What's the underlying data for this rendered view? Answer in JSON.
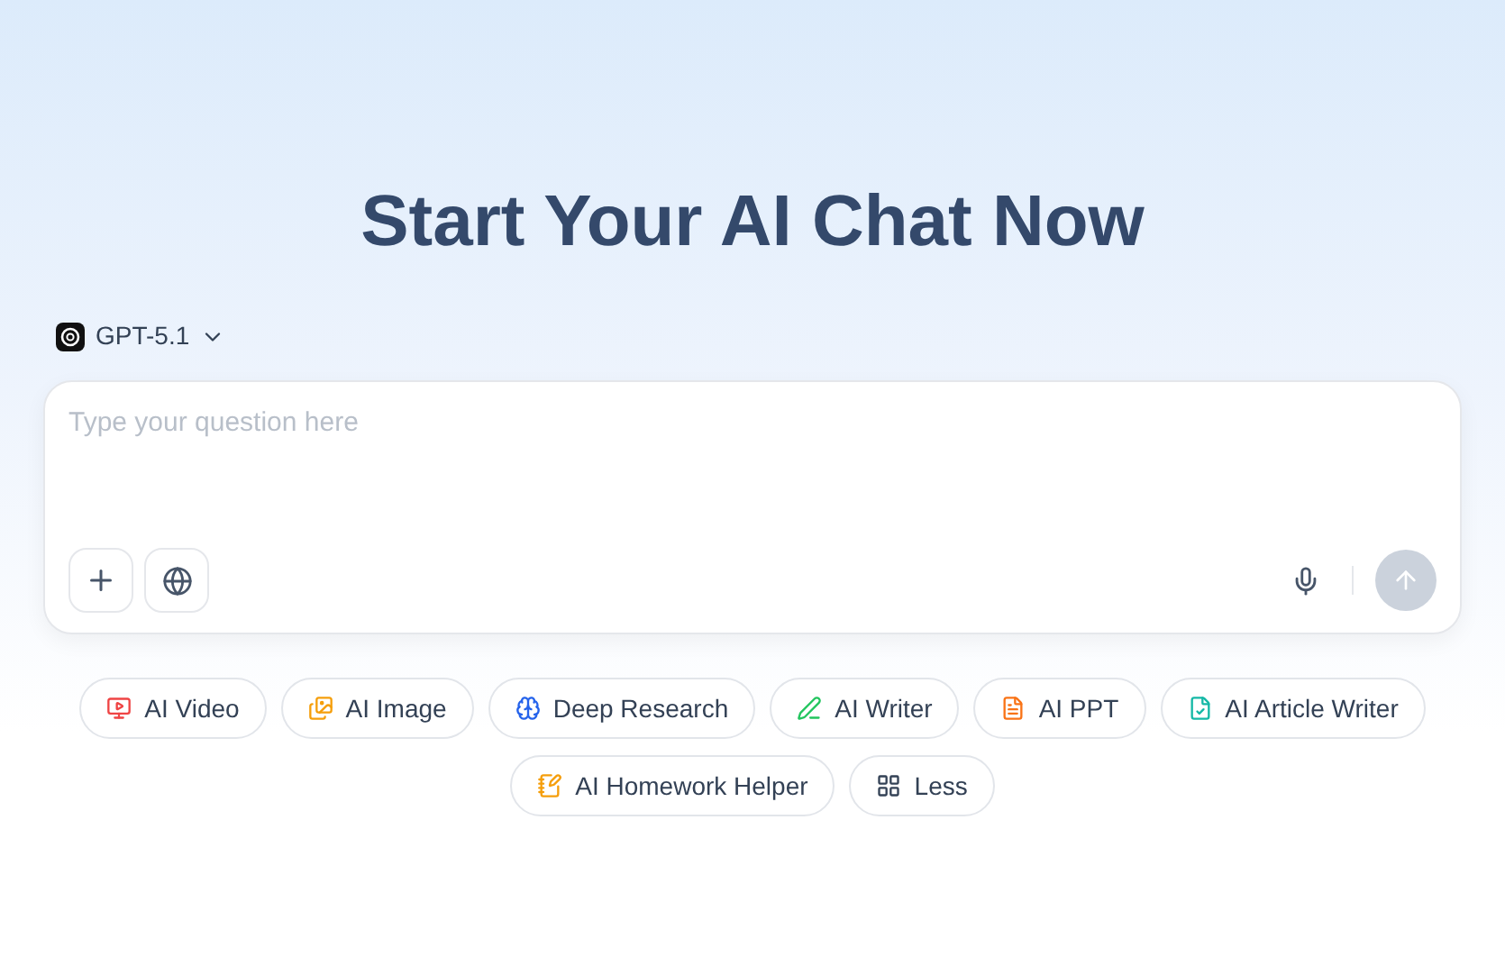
{
  "title": "Start Your AI Chat Now",
  "model": {
    "label": "GPT-5.1"
  },
  "composer": {
    "placeholder": "Type your question here"
  },
  "chips": [
    {
      "kind": "video",
      "label": "AI Video",
      "color": "#ef4444"
    },
    {
      "kind": "image",
      "label": "AI Image",
      "color": "#f59e0b"
    },
    {
      "kind": "research",
      "label": "Deep Research",
      "color": "#2563eb"
    },
    {
      "kind": "writer",
      "label": "AI Writer",
      "color": "#22c55e"
    },
    {
      "kind": "ppt",
      "label": "AI PPT",
      "color": "#f97316"
    },
    {
      "kind": "article",
      "label": "AI Article Writer",
      "color": "#14b8a6"
    },
    {
      "kind": "homework",
      "label": "AI Homework Helper",
      "color": "#f59e0b"
    },
    {
      "kind": "less",
      "label": "Less",
      "color": "#334155"
    }
  ]
}
